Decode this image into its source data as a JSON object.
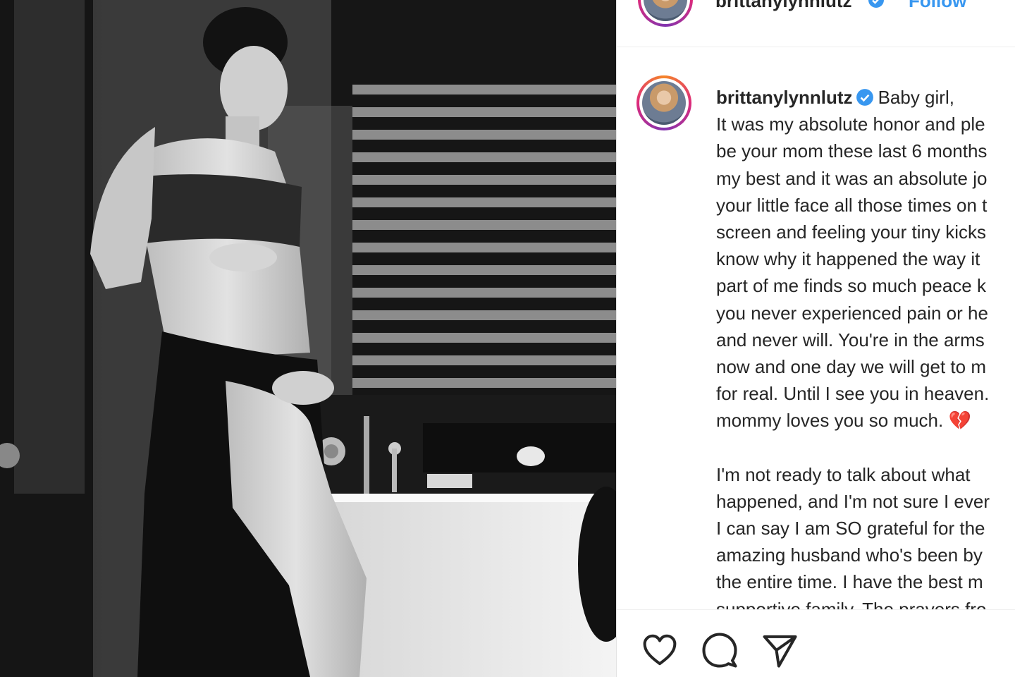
{
  "post": {
    "username": "brittanylynnlutz",
    "follow_label": "Follow",
    "verified": true,
    "caption_first": "Baby girl,",
    "caption_lines": [
      "It was my absolute honor and ple",
      "be your mom these last 6 months",
      "my best and it was an absolute jo",
      "your little face all those times on t",
      "screen and feeling your tiny kicks",
      "know why it happened the way it",
      "part of me finds so much peace k",
      "you never experienced pain or he",
      "and never will. You're in the arms",
      "now and one day we will get to m",
      "for real. Until I see you in heaven."
    ],
    "caption_last": "mommy loves you so much.",
    "caption_emoji": "💔",
    "caption_lines_2": [
      "I'm not ready to talk about what",
      "happened, and I'm not sure I ever",
      "I can say I am SO grateful for the",
      "amazing husband who's been by",
      "the entire time. I have the best m",
      "supportive family. The prayers fro"
    ]
  },
  "icons": {
    "like": "heart-icon",
    "comment": "comment-icon",
    "share": "paper-plane-icon",
    "verified": "verified-badge-icon"
  },
  "colors": {
    "verified": "#3897f0",
    "link": "#3897f0",
    "text": "#262626",
    "broken_heart": "#e0245e"
  }
}
